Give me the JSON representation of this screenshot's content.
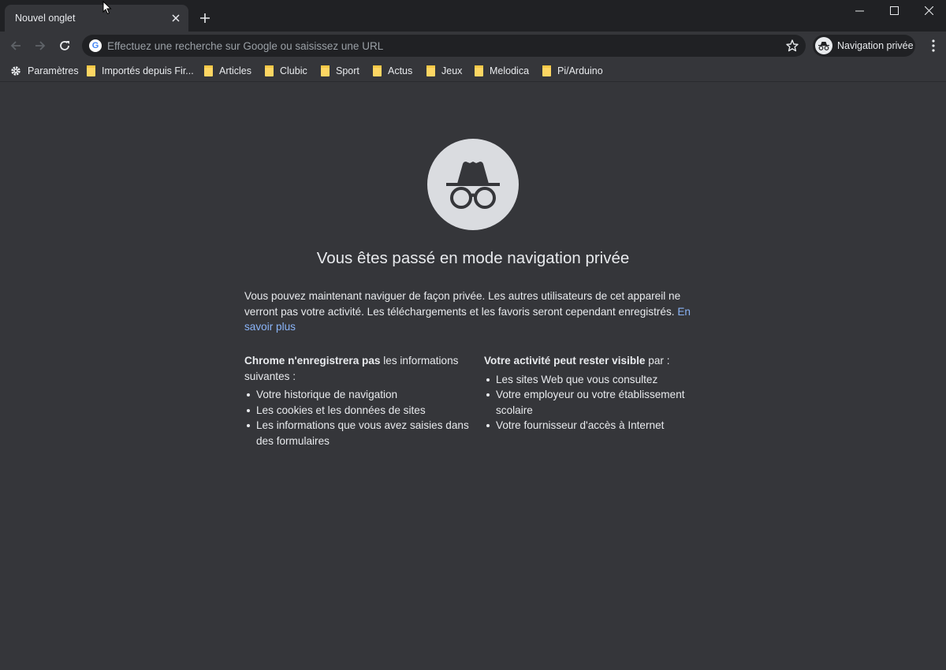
{
  "tab": {
    "title": "Nouvel onglet"
  },
  "omnibox": {
    "placeholder": "Effectuez une recherche sur Google ou saisissez une URL"
  },
  "profile": {
    "label": "Navigation privée"
  },
  "bookmarks": {
    "settings_label": "Paramètres",
    "folders": [
      "Importés depuis Fir...",
      "Articles",
      "Clubic",
      "Sport",
      "Actus",
      "Jeux",
      "Melodica",
      "Pi/Arduino"
    ]
  },
  "incognito": {
    "heading": "Vous êtes passé en mode navigation privée",
    "intro": "Vous pouvez maintenant naviguer de façon privée. Les autres utilisateurs de cet appareil ne verront pas votre activité. Les téléchargements et les favoris seront cependant enregistrés.",
    "learn_more": "En savoir plus",
    "left_title_bold": "Chrome n'enregistrera pas",
    "left_title_rest": " les informations suivantes :",
    "left_items": [
      "Votre historique de navigation",
      "Les cookies et les données de sites",
      "Les informations que vous avez saisies dans des formulaires"
    ],
    "right_title_bold": "Votre activité peut rester visible",
    "right_title_rest": " par :",
    "right_items": [
      "Les sites Web que vous consultez",
      "Votre employeur ou votre établissement scolaire",
      "Votre fournisseur d'accès à Internet"
    ]
  }
}
